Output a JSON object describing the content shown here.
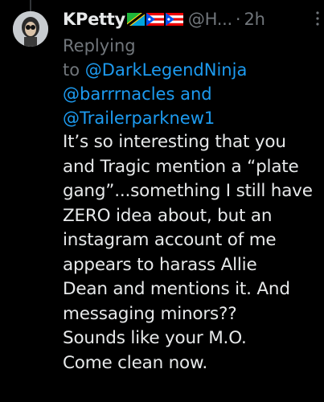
{
  "tweet": {
    "display_name": "KPetty",
    "handle": "@H...",
    "separator": "·",
    "time": "2h",
    "replying": {
      "prefix": "Replying",
      "to_word": "to",
      "mention_1": "@DarkLegendNinja",
      "mention_2": "@barrrnacles",
      "and_word": "and",
      "mention_3": "@Trailerparknew1"
    },
    "text_lines": [
      "It’s so interesting that you",
      "and Tragic mention a “plate",
      "gang”...something I still have",
      "ZERO idea about, but an",
      "instagram account of me",
      "appears to harass Allie",
      "Dean and mentions it. And",
      "messaging minors??",
      "Sounds like your M.O.",
      "Come clean now."
    ],
    "flags": [
      "tanzania-flag-icon",
      "puerto-rico-flag-icon",
      "puerto-rico-flag-icon"
    ]
  },
  "colors": {
    "background": "#000000",
    "text": "#e7e9ea",
    "secondary": "#71767b",
    "link": "#1d9bf0"
  }
}
